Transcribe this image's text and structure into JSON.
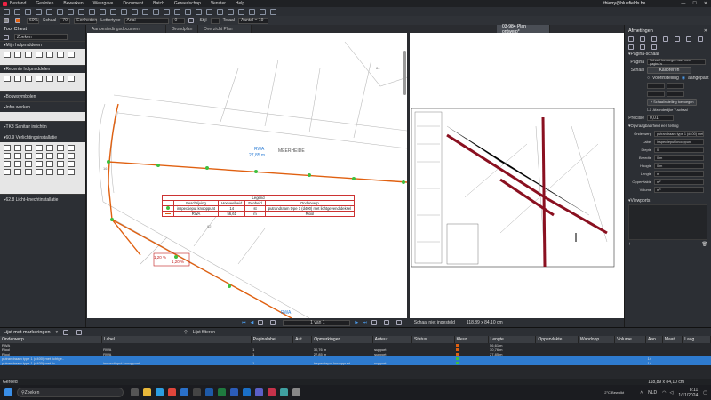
{
  "window": {
    "user": "thierry@bluefields.be"
  },
  "menu": [
    "Bestand",
    "Gesloten",
    "Bewerken",
    "Weergave",
    "Document",
    "Batch",
    "Gereedschap",
    "Venster",
    "Help"
  ],
  "props_bar": {
    "opacity": "60%",
    "scale_label": "Schaal",
    "scale_value": "70",
    "unit": "Eenheden",
    "font_label": "Lettertype",
    "font": "Arial",
    "size": "0",
    "style_label": "Stijl",
    "count_label": "Totaal",
    "count": "Aantal = 19"
  },
  "tool_chest": {
    "title": "Tool Chest",
    "search_placeholder": "Zoeken",
    "sections": [
      {
        "label": "Mijn hulpmiddelen"
      },
      {
        "label": "Recente hulpmiddelen"
      },
      {
        "label": "Bouwsymbolen"
      },
      {
        "label": "Infra werken"
      },
      {
        "label": "TK3 Sanitair inrichtin"
      },
      {
        "label": "60.9 Verlichtingsinstallatie"
      },
      {
        "label": "62.8 Licht-knechtinstallatie"
      }
    ]
  },
  "doc_tabs": [
    {
      "label": "Aanbestedingsdocument"
    },
    {
      "label": "Grondplan"
    },
    {
      "label": "Overzicht Plan"
    },
    {
      "label": "03-984 Plan ontwerp*"
    }
  ],
  "plan": {
    "rwa_label": "RWA",
    "rwa_length": "27,85 m",
    "street": "MEERHEIDE",
    "house_a": "84",
    "house_b": "82",
    "house_c": "16",
    "slope_labels": [
      "1,20 %",
      "1,20 %"
    ],
    "legend": {
      "title": "Legend",
      "headers": [
        "Beschrijving",
        "Hoeveelheid",
        "Eenheid",
        "Onderwerp"
      ],
      "rows": [
        [
          "inspectieput knooppunt",
          "14",
          "st",
          "putrandraam type 1 (d400) met lichtgevend deksel"
        ],
        [
          "RWA",
          "56,61",
          "m",
          "Riool"
        ]
      ]
    },
    "page_indicator": "1 van 1",
    "scale_status": "Schaal niet ingesteld",
    "dimensions": "118,89 x 84,10 cm"
  },
  "properties": {
    "title": "Afmetingen",
    "section_page": "Pagina-schaal",
    "pages_label": "Pagina",
    "pages_value": "Schaal toevoegen aan meer pagina's",
    "scale_label": "Schaal",
    "scale_btn": "Kalibreren",
    "preset_label": "Voorinstelling",
    "custom_label": "aangepast",
    "add_scale_btn": "+ Schaalinstelling toevoegen",
    "show_scale": "Afzonderlijke Y-schaal",
    "precision_label": "Precisie",
    "precision_value": "0,01",
    "section_depth": "Opvraagbaarheid een telling",
    "fields": [
      {
        "label": "Onderwerp",
        "value": "putrandraam type 1 (d400) met lichtgevend deksel"
      },
      {
        "label": "Label",
        "value": "inspectieput knooppunt"
      },
      {
        "label": "Diepte",
        "value": "0"
      },
      {
        "label": "Breedte",
        "value": "0 m"
      },
      {
        "label": "Hoogte",
        "value": "0 m"
      },
      {
        "label": "Lengte",
        "value": "m"
      },
      {
        "label": "Oppervlakte",
        "value": "m²"
      },
      {
        "label": "Volume",
        "value": "m³"
      }
    ],
    "viewports_label": "Viewports"
  },
  "markups": {
    "title": "Lijst met markeringen",
    "filter_btn": "Lijst filteren",
    "columns": [
      "Onderwerp",
      "Label",
      "Paginalabel",
      "Aut..",
      "Opmerkingen",
      "Auteur",
      "Status",
      "Kleur",
      "Lengte",
      "Oppervlakte",
      "Wandopp.",
      "Volume",
      "Aan",
      "Maat",
      "Laag"
    ],
    "rows": [
      {
        "subject": "RWA",
        "label": "",
        "page": "",
        "comment": "",
        "author": "",
        "length": "56,61 m",
        "count": "",
        "selected": false
      },
      {
        "subject": "Riool",
        "label": "RWA",
        "page": "1",
        "comment": "30,76 m",
        "author": "support",
        "length": "30,76 m",
        "count": "",
        "selected": false
      },
      {
        "subject": "Riool",
        "label": "RWA",
        "page": "1",
        "comment": "27,85 m",
        "author": "support",
        "length": "27,85 m",
        "count": "",
        "selected": false
      },
      {
        "subject": "putrandraam type 1 (d400) met lichtge..",
        "label": "",
        "page": "",
        "comment": "",
        "author": "",
        "length": "",
        "count": "14",
        "selected": true
      },
      {
        "subject": "putrandraam type 1 (d400) met lic",
        "label": "inspectieput knooppunt",
        "page": "1",
        "comment": "inspectieput knooppunt",
        "author": "support",
        "length": "",
        "count": "14",
        "selected": true
      }
    ]
  },
  "status": {
    "left": "Gereed",
    "coords": "118,89 x 84,10 cm"
  },
  "taskbar": {
    "search": "Zoeken",
    "weather": "2°C Bewolkt",
    "lang": "NLD",
    "time": "8:11",
    "date": "1/11/2024"
  },
  "colors": {
    "accent": "#2f7fd6",
    "route": "#e06010",
    "selected_row": "#2e7bcf",
    "red_line": "#c01c1c"
  }
}
